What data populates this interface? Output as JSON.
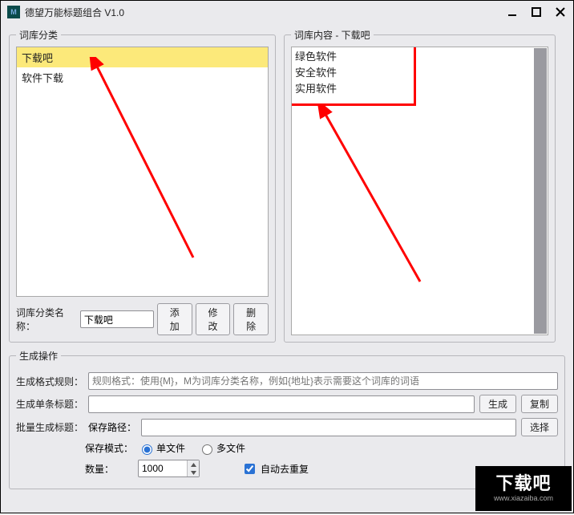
{
  "window": {
    "title": "德望万能标题组合  V1.0"
  },
  "left_panel": {
    "legend": "词库分类",
    "items": [
      {
        "label": "下载吧",
        "selected": true
      },
      {
        "label": "软件下载",
        "selected": false
      }
    ],
    "name_label": "词库分类名称：",
    "name_value": "下载吧",
    "btn_add": "添加",
    "btn_edit": "修改",
    "btn_delete": "删除"
  },
  "right_panel": {
    "legend": "词库内容 - 下载吧",
    "items": [
      "绿色软件",
      "安全软件",
      "实用软件"
    ]
  },
  "gen_panel": {
    "legend": "生成操作",
    "rule_label": "生成格式规则：",
    "rule_placeholder": "规则格式：使用{M}，M为词库分类名称，例如{地址}表示需要这个词库的词语",
    "single_label": "生成单条标题：",
    "btn_generate": "生成",
    "btn_copy": "复制",
    "batch_label": "批量生成标题：",
    "save_path_label": "保存路径：",
    "btn_browse": "选择",
    "save_mode_label": "保存模式：",
    "mode_single": "单文件",
    "mode_multi": "多文件",
    "qty_label": "数量：",
    "qty_value": "1000",
    "dedup_label": "自动去重复"
  },
  "watermark": {
    "big": "下载吧",
    "small": "www.xiazaiba.com"
  }
}
